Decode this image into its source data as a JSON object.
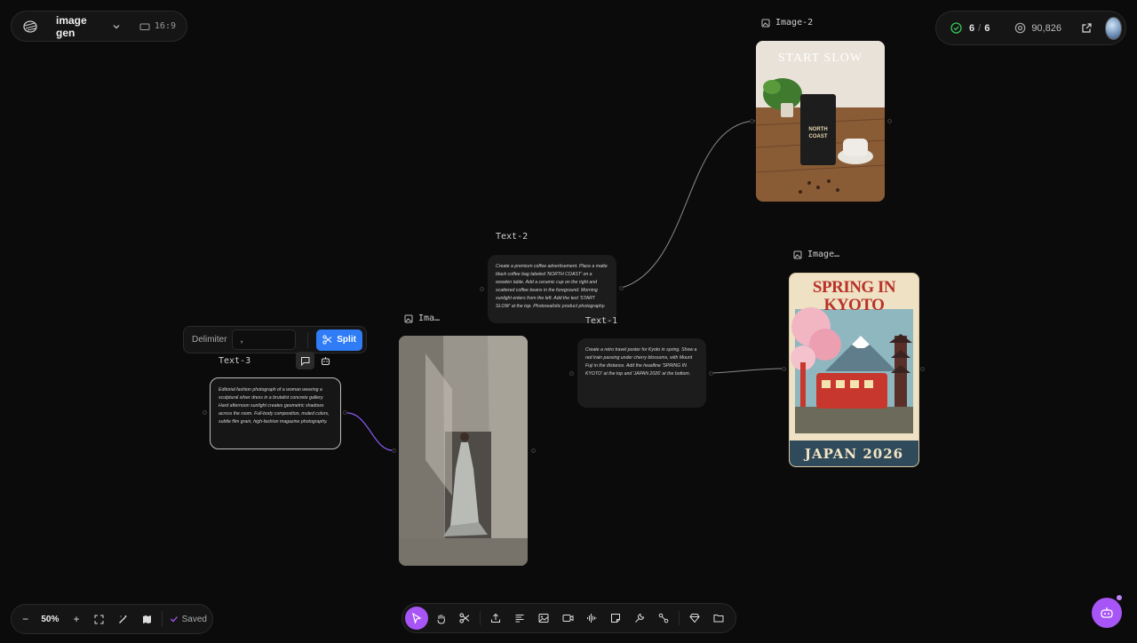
{
  "project": {
    "name": "image gen",
    "aspect": "16:9"
  },
  "status": {
    "progress_done": "6",
    "progress_sep": "/",
    "progress_total": "6",
    "credits": "90,826"
  },
  "nodes": {
    "image2": {
      "label": "Image-2",
      "headline": "START SLOW",
      "brand_line1": "NORTH",
      "brand_line2": "COAST"
    },
    "image_kyoto": {
      "label": "Image…",
      "headline": "SPRING IN KYOTO",
      "footer": "JAPAN 2026"
    },
    "image_fashion": {
      "label": "Ima…"
    },
    "text2": {
      "label": "Text-2",
      "prompt": "Create a premium coffee advertisement. Place a matte black coffee bag labeled 'NORTH COAST' on a wooden table. Add a ceramic cup on the right and scattered coffee beans in the foreground. Morning sunlight enters from the left. Add the text 'START SLOW' at the top. Photorealistic product photography."
    },
    "text1": {
      "label": "Text-1",
      "prompt": "Create a retro travel poster for Kyoto in spring. Show a red train passing under cherry blossoms, with Mount Fuji in the distance. Add the headline 'SPRING IN KYOTO' at the top and 'JAPAN 2026' at the bottom."
    },
    "text3": {
      "label": "Text-3",
      "prompt": "Editorial fashion photograph of a woman wearing a sculptural silver dress in a brutalist concrete gallery. Hard afternoon sunlight creates geometric shadows across the room. Full-body composition, muted colors, subtle film grain, high-fashion magazine photography."
    }
  },
  "split_panel": {
    "delimiter_label": "Delimiter",
    "delimiter_value": ",",
    "split_label": "Split"
  },
  "zoom": {
    "level": "50%",
    "minus": "−",
    "plus": "+",
    "saved_label": "Saved"
  },
  "colors": {
    "accent": "#a855f7",
    "split_blue": "#2f7cf6",
    "canvas": "#0b0b0b",
    "card": "#1c1c1c"
  }
}
